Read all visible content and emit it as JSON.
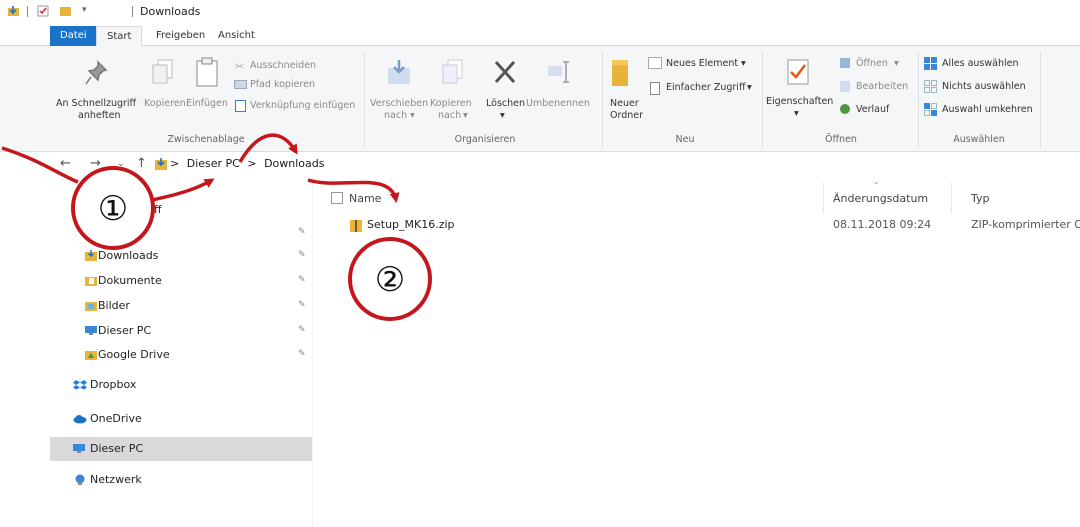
{
  "titlebar": {
    "title": "Downloads"
  },
  "tabs": {
    "file": "Datei",
    "start": "Start",
    "share": "Freigeben",
    "view": "Ansicht"
  },
  "ribbon": {
    "pin_line1": "An Schnellzugriff",
    "pin_line2": "anheften",
    "copy": "Kopieren",
    "paste": "Einfügen",
    "cut": "Ausschneiden",
    "copy_path": "Pfad kopieren",
    "paste_shortcut": "Verknüpfung einfügen",
    "group_clipboard": "Zwischenablage",
    "move_to_line1": "Verschieben",
    "move_to_line2": "nach",
    "copy_to_line1": "Kopieren",
    "copy_to_line2": "nach",
    "delete": "Löschen",
    "rename": "Umbenennen",
    "group_organize": "Organisieren",
    "new_folder_line1": "Neuer",
    "new_folder_line2": "Ordner",
    "new_item": "Neues Element",
    "easy_access": "Einfacher Zugriff",
    "group_new": "Neu",
    "properties": "Eigenschaften",
    "open": "Öffnen",
    "edit": "Bearbeiten",
    "history": "Verlauf",
    "group_open": "Öffnen",
    "select_all": "Alles auswählen",
    "select_none": "Nichts auswählen",
    "invert_selection": "Auswahl umkehren",
    "group_select": "Auswählen"
  },
  "address": {
    "crumb_1": "Dieser PC",
    "crumb_2": "Downloads",
    "separator": ">"
  },
  "navpane": {
    "quick_access_partial": "ff",
    "items": [
      {
        "label": "Downloads"
      },
      {
        "label": "Dokumente"
      },
      {
        "label": "Bilder"
      },
      {
        "label": "Dieser PC"
      },
      {
        "label": "Google Drive"
      },
      {
        "label": "Dropbox"
      },
      {
        "label": "OneDrive"
      },
      {
        "label": "Dieser PC"
      },
      {
        "label": "Netzwerk"
      }
    ]
  },
  "filelist": {
    "columns": {
      "name": "Name",
      "date": "Änderungsdatum",
      "type": "Typ"
    },
    "rows": [
      {
        "name": "Setup_MK16.zip",
        "date": "08.11.2018 09:24",
        "type": "ZIP-komprimierter O"
      }
    ]
  },
  "annotations": {
    "step1": "①",
    "step2": "②",
    "color": "#c4161c"
  },
  "colors": {
    "accent": "#1a73c8",
    "selection": "#d9d9d9",
    "folder": "#e8b339"
  }
}
